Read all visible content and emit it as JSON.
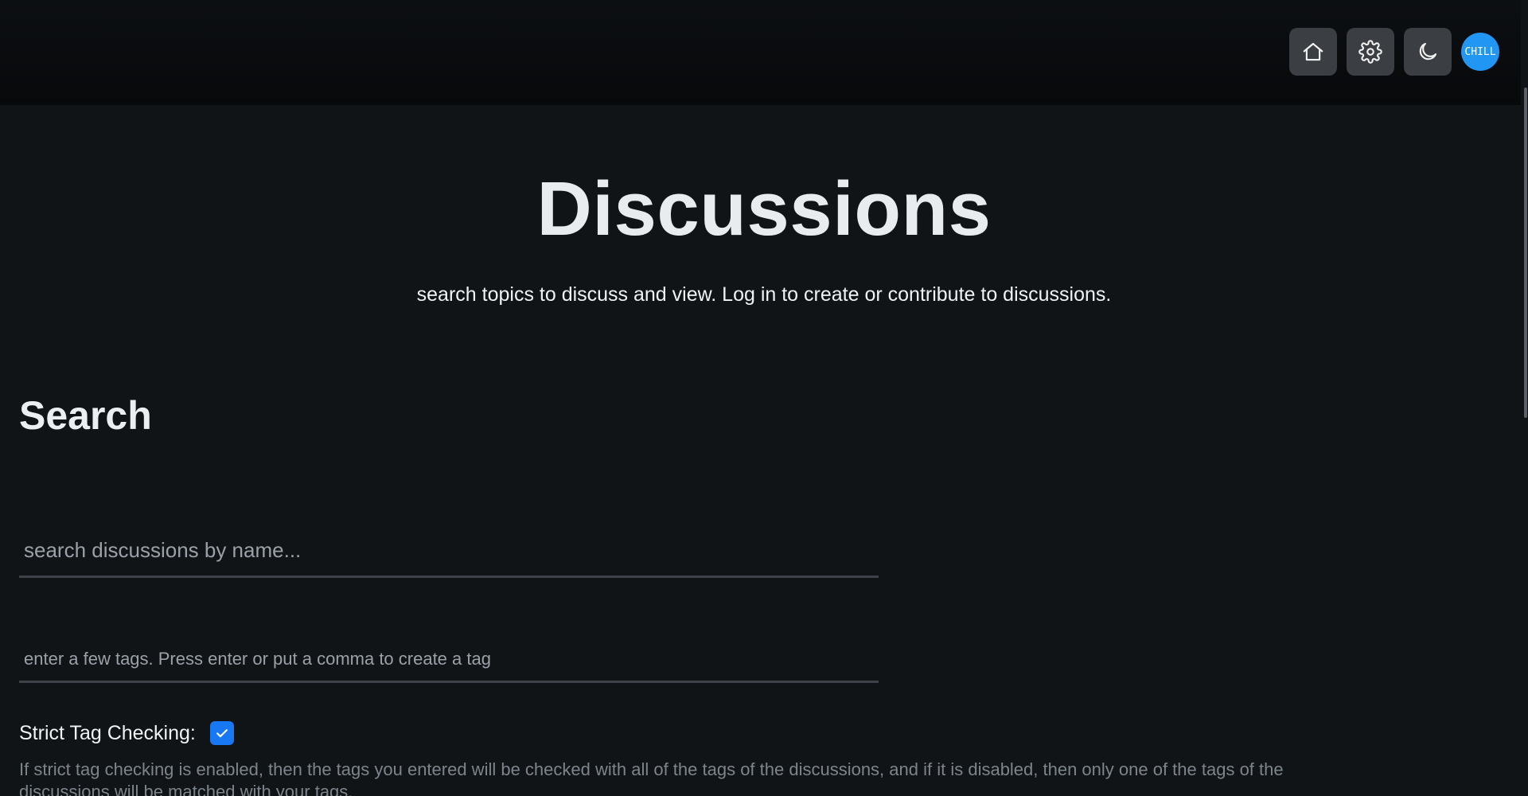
{
  "header": {
    "icons": [
      "home-icon",
      "gear-icon",
      "moon-icon"
    ],
    "avatar_label": "CHILL",
    "colors": {
      "avatar": "#2196f3",
      "icon_button": "#3b3e42"
    }
  },
  "hero": {
    "title": "Discussions",
    "subtitle": "search topics to discuss and view. Log in to create or contribute to discussions."
  },
  "search": {
    "title": "Search",
    "name_placeholder": "search discussions by name...",
    "tags_placeholder": "enter a few tags. Press enter or put a comma to create a tag",
    "strict_label": "Strict Tag Checking:",
    "strict_checked": true,
    "strict_help": "If strict tag checking is enabled, then the tags you entered will be checked with all of the tags of the discussions, and if it is disabled, then only one of the tags of the discussions will be matched with your tags."
  },
  "colors": {
    "background": "#101416",
    "accent": "#1877f2"
  }
}
